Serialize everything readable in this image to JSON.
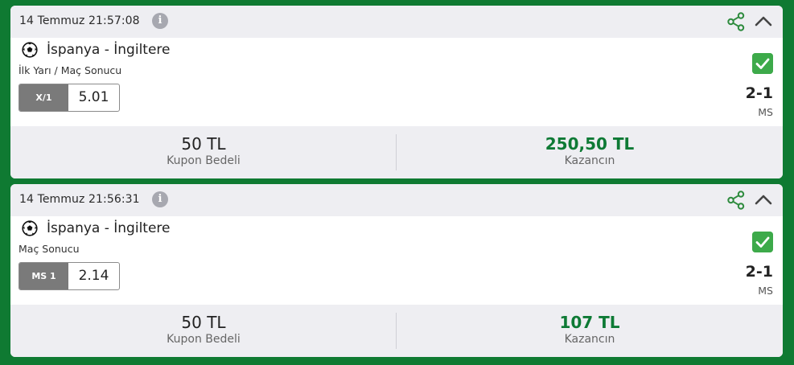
{
  "coupons": [
    {
      "date": "14 Temmuz 21:57:08",
      "match": "İspanya - İngiltere",
      "market": "İlk Yarı / Maç Sonucu",
      "pick": "X/1",
      "odd": "5.01",
      "score": "2-1",
      "score_label": "MS",
      "stake": "50 TL",
      "stake_label": "Kupon Bedeli",
      "win": "250,50 TL",
      "win_label": "Kazancın",
      "status": "won"
    },
    {
      "date": "14 Temmuz 21:56:31",
      "match": "İspanya - İngiltere",
      "market": "Maç Sonucu",
      "pick": "MS 1",
      "odd": "2.14",
      "score": "2-1",
      "score_label": "MS",
      "stake": "50 TL",
      "stake_label": "Kupon Bedeli",
      "win": "107 TL",
      "win_label": "Kazancın",
      "status": "won"
    }
  ],
  "icons": {
    "info": "info-icon",
    "share": "share-icon",
    "collapse": "chevron-up-icon",
    "sport": "soccer-ball-icon",
    "status": "check-icon"
  },
  "colors": {
    "background": "#0f7a32",
    "accent_green": "#0e7a35",
    "check_green": "#3daa4a",
    "pick_bg": "#7a7a7a"
  }
}
